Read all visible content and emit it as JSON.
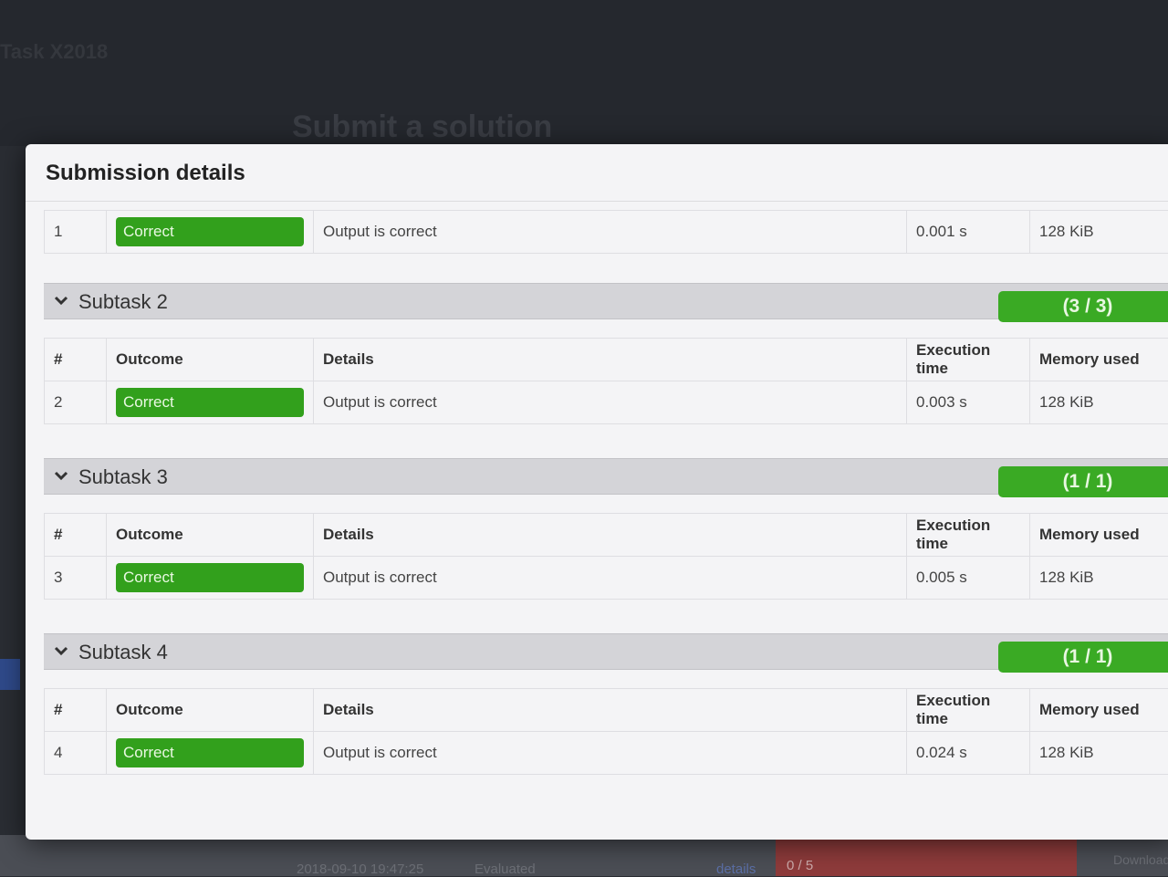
{
  "background": {
    "heading": "Submit a solution",
    "corner_text": "Task X2018",
    "row": {
      "date": "2018-09-10 19:47:25",
      "status": "Evaluated",
      "details_link": "details",
      "score": "0 / 5",
      "download": "Download"
    }
  },
  "modal": {
    "title": "Submission details",
    "columns": {
      "num": "#",
      "outcome": "Outcome",
      "details": "Details",
      "time": "Execution time",
      "memory": "Memory used"
    },
    "subtask1_rows": [
      {
        "num": "1",
        "outcome": "Correct",
        "details": "Output is correct",
        "time": "0.001 s",
        "memory": "128 KiB"
      }
    ],
    "subtasks": [
      {
        "name": "Subtask 2",
        "score": "(3 / 3)",
        "rows": [
          {
            "num": "2",
            "outcome": "Correct",
            "details": "Output is correct",
            "time": "0.003 s",
            "memory": "128 KiB"
          }
        ]
      },
      {
        "name": "Subtask 3",
        "score": "(1 / 1)",
        "rows": [
          {
            "num": "3",
            "outcome": "Correct",
            "details": "Output is correct",
            "time": "0.005 s",
            "memory": "128 KiB"
          }
        ]
      },
      {
        "name": "Subtask 4",
        "score": "(1 / 1)",
        "rows": [
          {
            "num": "4",
            "outcome": "Correct",
            "details": "Output is correct",
            "time": "0.024 s",
            "memory": "128 KiB"
          }
        ]
      }
    ]
  },
  "colors": {
    "success": "#32a01c",
    "score_badge": "#3aaa24",
    "subtask_header": "#d4d4d8"
  },
  "icons": {
    "subtask_toggle": "chevron-down-icon"
  }
}
